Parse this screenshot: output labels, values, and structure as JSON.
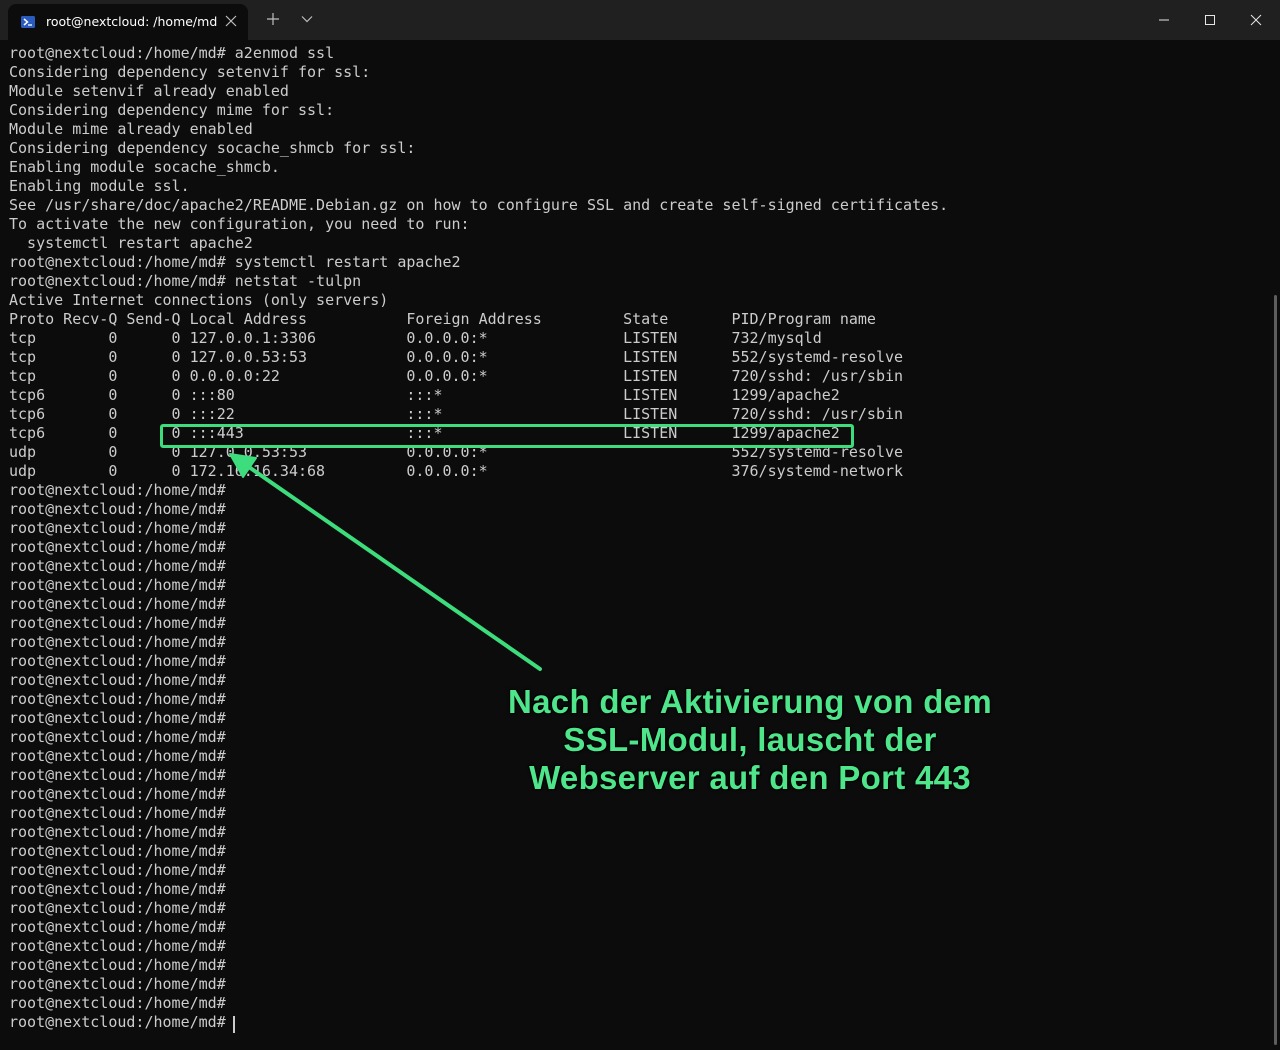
{
  "window": {
    "tab_title": "root@nextcloud: /home/md",
    "icons": {
      "tab_icon": "terminal-icon",
      "tab_close": "close-icon",
      "new_tab": "plus-icon",
      "dropdown": "chevron-down-icon",
      "minimize": "minimize-icon",
      "maximize": "maximize-icon",
      "close": "close-icon"
    }
  },
  "terminal": {
    "lines": [
      "root@nextcloud:/home/md# a2enmod ssl",
      "Considering dependency setenvif for ssl:",
      "Module setenvif already enabled",
      "Considering dependency mime for ssl:",
      "Module mime already enabled",
      "Considering dependency socache_shmcb for ssl:",
      "Enabling module socache_shmcb.",
      "Enabling module ssl.",
      "See /usr/share/doc/apache2/README.Debian.gz on how to configure SSL and create self-signed certificates.",
      "To activate the new configuration, you need to run:",
      "  systemctl restart apache2",
      "root@nextcloud:/home/md# systemctl restart apache2",
      "root@nextcloud:/home/md# netstat -tulpn",
      "Active Internet connections (only servers)",
      "Proto Recv-Q Send-Q Local Address           Foreign Address         State       PID/Program name",
      "tcp        0      0 127.0.0.1:3306          0.0.0.0:*               LISTEN      732/mysqld",
      "tcp        0      0 127.0.0.53:53           0.0.0.0:*               LISTEN      552/systemd-resolve",
      "tcp        0      0 0.0.0.0:22              0.0.0.0:*               LISTEN      720/sshd: /usr/sbin",
      "tcp6       0      0 :::80                   :::*                    LISTEN      1299/apache2",
      "tcp6       0      0 :::22                   :::*                    LISTEN      720/sshd: /usr/sbin",
      "tcp6       0      0 :::443                  :::*                    LISTEN      1299/apache2",
      "udp        0      0 127.0.0.53:53           0.0.0.0:*                           552/systemd-resolve",
      "udp        0      0 172.16.16.34:68         0.0.0.0:*                           376/systemd-network",
      "root@nextcloud:/home/md#",
      "root@nextcloud:/home/md#",
      "root@nextcloud:/home/md#",
      "root@nextcloud:/home/md#",
      "root@nextcloud:/home/md#",
      "root@nextcloud:/home/md#",
      "root@nextcloud:/home/md#",
      "root@nextcloud:/home/md#",
      "root@nextcloud:/home/md#",
      "root@nextcloud:/home/md#",
      "root@nextcloud:/home/md#",
      "root@nextcloud:/home/md#",
      "root@nextcloud:/home/md#",
      "root@nextcloud:/home/md#",
      "root@nextcloud:/home/md#",
      "root@nextcloud:/home/md#",
      "root@nextcloud:/home/md#",
      "root@nextcloud:/home/md#",
      "root@nextcloud:/home/md#",
      "root@nextcloud:/home/md#",
      "root@nextcloud:/home/md#",
      "root@nextcloud:/home/md#",
      "root@nextcloud:/home/md#",
      "root@nextcloud:/home/md#",
      "root@nextcloud:/home/md#",
      "root@nextcloud:/home/md#",
      "root@nextcloud:/home/md#",
      "root@nextcloud:/home/md#",
      "root@nextcloud:/home/md#"
    ]
  },
  "annotation": {
    "lines": [
      "Nach der Aktivierung von dem",
      "SSL-Modul, lauscht der",
      "Webserver auf den Port 443"
    ],
    "color": "#4ee58b"
  },
  "colors": {
    "background": "#0c0c0c",
    "titlebar": "#202020",
    "text": "#cccccc",
    "highlight": "#3ddc7c"
  }
}
